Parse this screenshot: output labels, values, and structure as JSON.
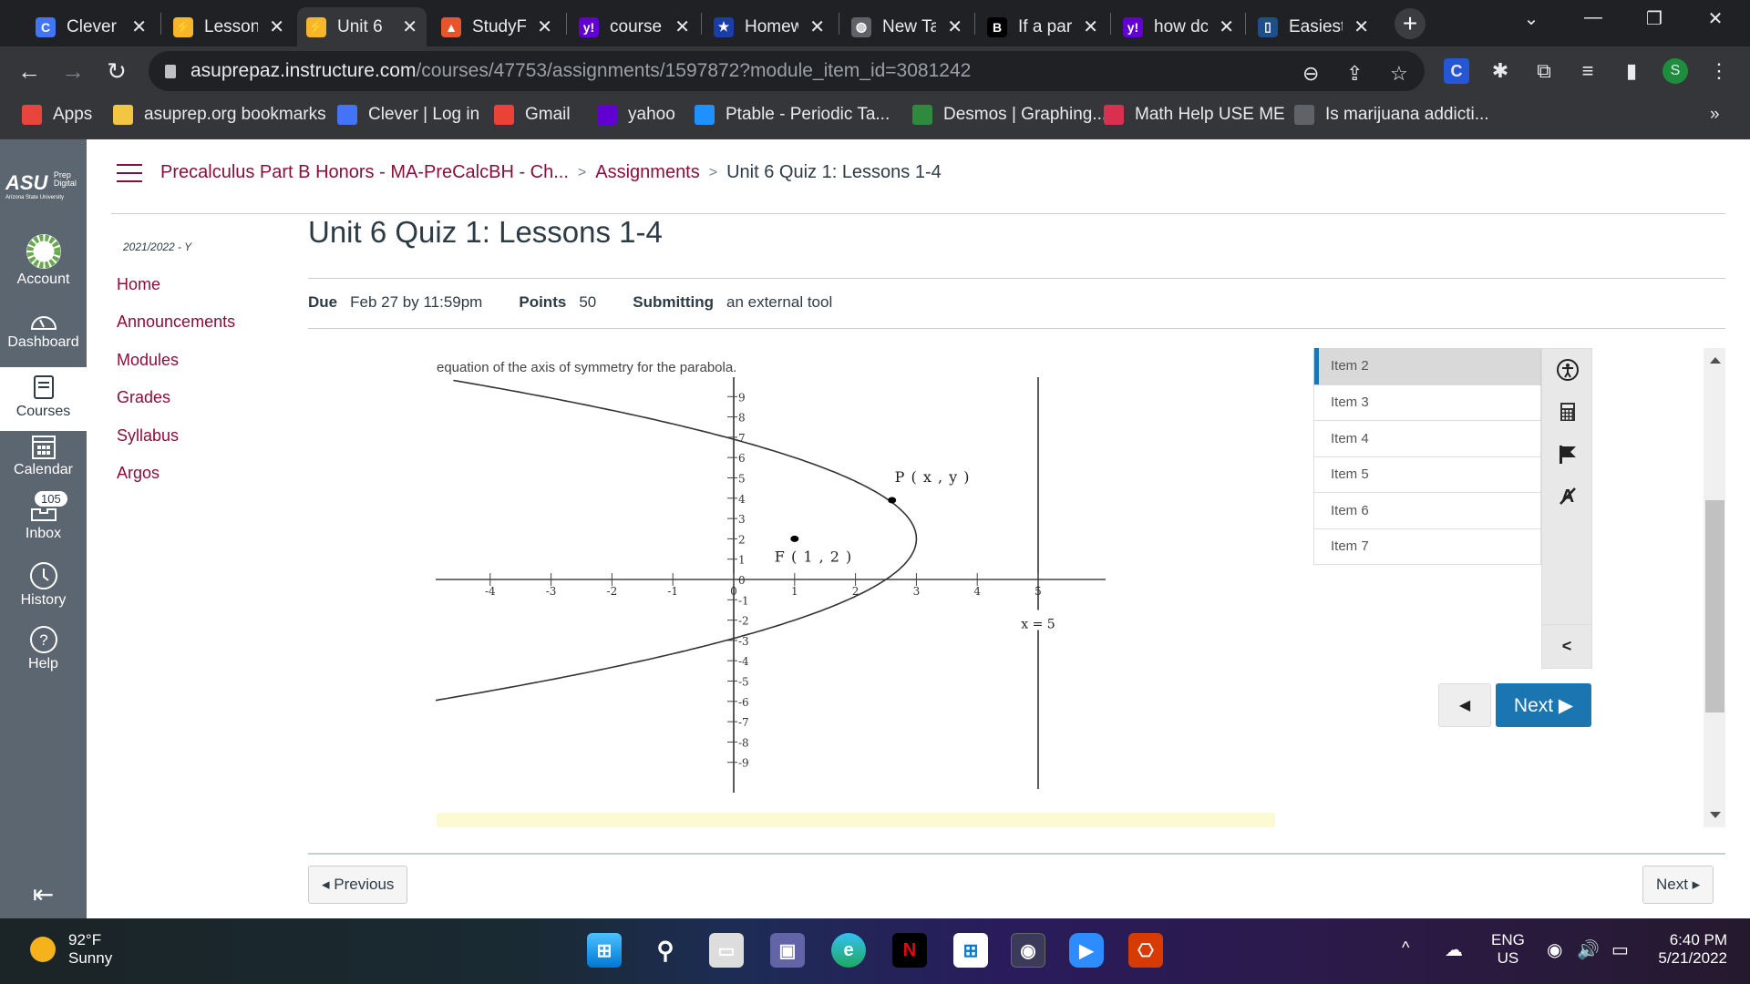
{
  "browser": {
    "tabs": [
      {
        "title": "Clever",
        "icon": "clever-icon",
        "color": "#4274f6",
        "glyph": "C"
      },
      {
        "title": "Lesson",
        "icon": "edgenuity-icon",
        "color": "#f7b52c",
        "glyph": "⚡"
      },
      {
        "title": "Unit 6",
        "icon": "edgenuity-icon",
        "color": "#f7b52c",
        "glyph": "⚡",
        "active": true
      },
      {
        "title": "StudyF",
        "icon": "studyfetch-icon",
        "color": "#e8542b",
        "glyph": "▲"
      },
      {
        "title": "course",
        "icon": "yahoo-icon",
        "color": "#6001d2",
        "glyph": "y!"
      },
      {
        "title": "Homew",
        "icon": "bookmark-star-icon",
        "color": "#1a3ea8",
        "glyph": "★"
      },
      {
        "title": "New Ta",
        "icon": "globe-icon",
        "color": "#5f6368",
        "glyph": "◍"
      },
      {
        "title": "If a par",
        "icon": "brainly-icon",
        "color": "#000000",
        "glyph": "B"
      },
      {
        "title": "how dc",
        "icon": "yahoo-icon",
        "color": "#6001d2",
        "glyph": "y!"
      },
      {
        "title": "Easiest",
        "icon": "phone-icon",
        "color": "#1e4e8c",
        "glyph": "▯"
      }
    ],
    "new_tab_label": "+",
    "url_host": "asuprepaz.instructure.com",
    "url_path": "/courses/47753/assignments/1597872?module_item_id=3081242",
    "profile_initial": "S",
    "bookmarks": [
      {
        "label": "Apps",
        "icon": "apps-grid-icon",
        "color": "#e8453c"
      },
      {
        "label": "asuprep.org bookmarks",
        "icon": "folder-icon",
        "color": "#f4c542"
      },
      {
        "label": "Clever | Log in",
        "icon": "clever-icon",
        "color": "#4274f6"
      },
      {
        "label": "Gmail",
        "icon": "gmail-icon",
        "color": "#ea4335"
      },
      {
        "label": "yahoo",
        "icon": "yahoo-mail-icon",
        "color": "#6001d2"
      },
      {
        "label": "Ptable - Periodic Ta...",
        "icon": "ptable-icon",
        "color": "#1e90ff"
      },
      {
        "label": "Desmos | Graphing...",
        "icon": "desmos-icon",
        "color": "#2e8b3d"
      },
      {
        "label": "Math Help USE ME",
        "icon": "mathhelp-icon",
        "color": "#d9304f"
      },
      {
        "label": "Is marijuana addicti...",
        "icon": "bookmark-icon",
        "color": "#5f6368"
      }
    ],
    "overflow_label": "»"
  },
  "global_nav": {
    "logo_text": "ASU",
    "logo_sub1": "Prep",
    "logo_sub2": "Digital",
    "logo_tagline": "Arizona State University",
    "items": [
      {
        "label": "Account",
        "icon": "account-avatar-icon"
      },
      {
        "label": "Dashboard",
        "icon": "dashboard-icon"
      },
      {
        "label": "Courses",
        "icon": "courses-icon",
        "active": true
      },
      {
        "label": "Calendar",
        "icon": "calendar-icon"
      },
      {
        "label": "Inbox",
        "icon": "inbox-icon",
        "badge": "105"
      },
      {
        "label": "History",
        "icon": "history-icon"
      },
      {
        "label": "Help",
        "icon": "help-icon"
      }
    ]
  },
  "breadcrumb": {
    "course": "Precalculus Part B Honors - MA-PreCalcBH - Ch...",
    "section": "Assignments",
    "current": "Unit 6 Quiz 1: Lessons 1-4",
    "separator": ">"
  },
  "course_nav": {
    "term": "2021/2022 - Y",
    "items": [
      "Home",
      "Announcements",
      "Modules",
      "Grades",
      "Syllabus",
      "Argos"
    ]
  },
  "assignment": {
    "title": "Unit 6 Quiz 1: Lessons 1-4",
    "due_label": "Due",
    "due_value": "Feb 27 by 11:59pm",
    "points_label": "Points",
    "points_value": "50",
    "submitting_label": "Submitting",
    "submitting_value": "an external tool"
  },
  "quiz": {
    "question_text": "equation of the axis of symmetry for the parabola.",
    "items": [
      "Item 2",
      "Item 3",
      "Item 4",
      "Item 5",
      "Item 6",
      "Item 7"
    ],
    "current_item": "Item 2",
    "tools": [
      "accessibility-icon",
      "calculator-icon",
      "flag-icon",
      "strikethrough-eliminator-icon"
    ],
    "collapse_label": "<",
    "prev_label": "◀",
    "next_label": "Next ▶",
    "accent_color": "#1b75b0"
  },
  "chart_data": {
    "type": "line",
    "title": "",
    "xlabel": "",
    "ylabel": "",
    "xlim": [
      -5,
      6
    ],
    "ylim": [
      -10,
      10
    ],
    "x_ticks": [
      -4,
      -3,
      -2,
      -1,
      0,
      1,
      2,
      3,
      4,
      5
    ],
    "y_ticks": [
      9,
      8,
      7,
      6,
      5,
      4,
      3,
      2,
      1,
      0,
      -1,
      -2,
      -3,
      -4,
      -5,
      -6,
      -7,
      -8,
      -9
    ],
    "grid": false,
    "series": [
      {
        "name": "parabola",
        "equation": "(y-2)^2 = -8(x-3)",
        "vertex": [
          3,
          2
        ],
        "y_range": [
          -6.1,
          9.8
        ]
      }
    ],
    "directrix": {
      "x": 5,
      "label": "x = 5"
    },
    "points": [
      {
        "label": "F ( 1 , 2 )",
        "x": 1,
        "y": 2
      },
      {
        "label": "P ( x , y )",
        "x": 2.6,
        "y": 3.9
      }
    ]
  },
  "page_nav": {
    "previous_label": "◂ Previous",
    "next_label": "Next ▸"
  },
  "taskbar": {
    "temperature": "92°F",
    "condition": "Sunny",
    "apps": [
      "windows-start-icon",
      "search-icon",
      "task-view-icon",
      "teams-chat-icon",
      "edge-icon",
      "netflix-icon",
      "store-icon",
      "chrome-icon",
      "zoom-icon",
      "office-icon"
    ],
    "language": "ENG",
    "region": "US",
    "time": "6:40 PM",
    "date": "5/21/2022"
  }
}
